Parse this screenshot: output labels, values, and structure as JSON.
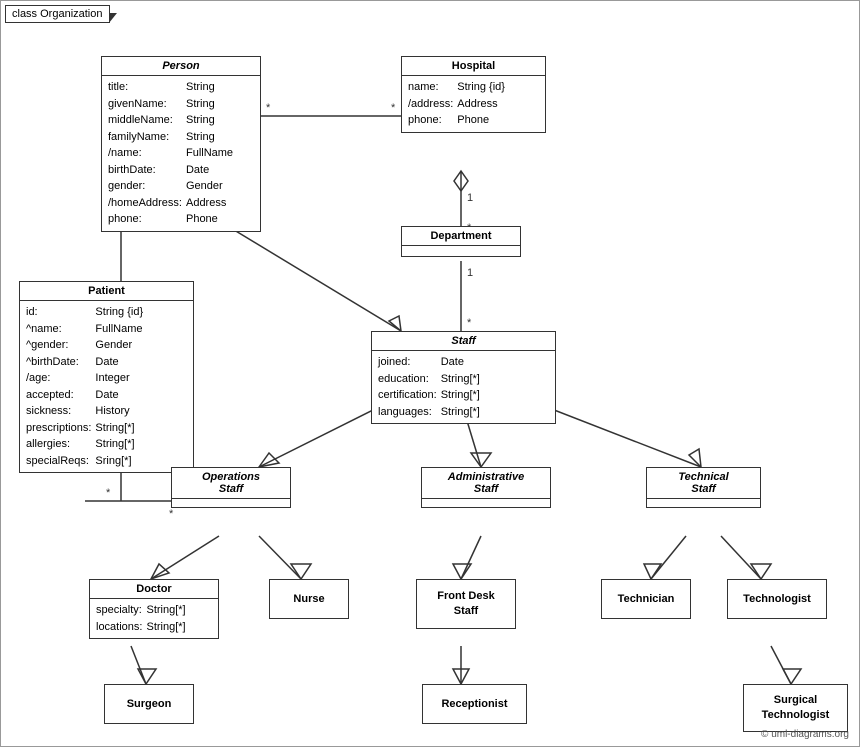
{
  "title": "class Organization",
  "copyright": "© uml-diagrams.org",
  "classes": {
    "person": {
      "name": "Person",
      "italic": true,
      "attributes": [
        [
          "title:",
          "String"
        ],
        [
          "givenName:",
          "String"
        ],
        [
          "middleName:",
          "String"
        ],
        [
          "familyName:",
          "String"
        ],
        [
          "/name:",
          "FullName"
        ],
        [
          "birthDate:",
          "Date"
        ],
        [
          "gender:",
          "Gender"
        ],
        [
          "/homeAddress:",
          "Address"
        ],
        [
          "phone:",
          "Phone"
        ]
      ]
    },
    "hospital": {
      "name": "Hospital",
      "italic": false,
      "attributes": [
        [
          "name:",
          "String {id}"
        ],
        [
          "/address:",
          "Address"
        ],
        [
          "phone:",
          "Phone"
        ]
      ]
    },
    "patient": {
      "name": "Patient",
      "italic": false,
      "attributes": [
        [
          "id:",
          "String {id}"
        ],
        [
          "^name:",
          "FullName"
        ],
        [
          "^gender:",
          "Gender"
        ],
        [
          "^birthDate:",
          "Date"
        ],
        [
          "/age:",
          "Integer"
        ],
        [
          "accepted:",
          "Date"
        ],
        [
          "sickness:",
          "History"
        ],
        [
          "prescriptions:",
          "String[*]"
        ],
        [
          "allergies:",
          "String[*]"
        ],
        [
          "specialReqs:",
          "Sring[*]"
        ]
      ]
    },
    "department": {
      "name": "Department"
    },
    "staff": {
      "name": "Staff",
      "italic": true,
      "attributes": [
        [
          "joined:",
          "Date"
        ],
        [
          "education:",
          "String[*]"
        ],
        [
          "certification:",
          "String[*]"
        ],
        [
          "languages:",
          "String[*]"
        ]
      ]
    },
    "operationsStaff": {
      "name": "Operations\nStaff",
      "italic": true
    },
    "administrativeStaff": {
      "name": "Administrative\nStaff",
      "italic": true
    },
    "technicalStaff": {
      "name": "Technical\nStaff",
      "italic": true
    },
    "doctor": {
      "name": "Doctor",
      "attributes": [
        [
          "specialty:",
          "String[*]"
        ],
        [
          "locations:",
          "String[*]"
        ]
      ]
    },
    "nurse": {
      "name": "Nurse"
    },
    "frontDeskStaff": {
      "name": "Front Desk\nStaff"
    },
    "technician": {
      "name": "Technician"
    },
    "technologist": {
      "name": "Technologist"
    },
    "surgeon": {
      "name": "Surgeon"
    },
    "receptionist": {
      "name": "Receptionist"
    },
    "surgicalTechnologist": {
      "name": "Surgical\nTechnologist"
    }
  }
}
